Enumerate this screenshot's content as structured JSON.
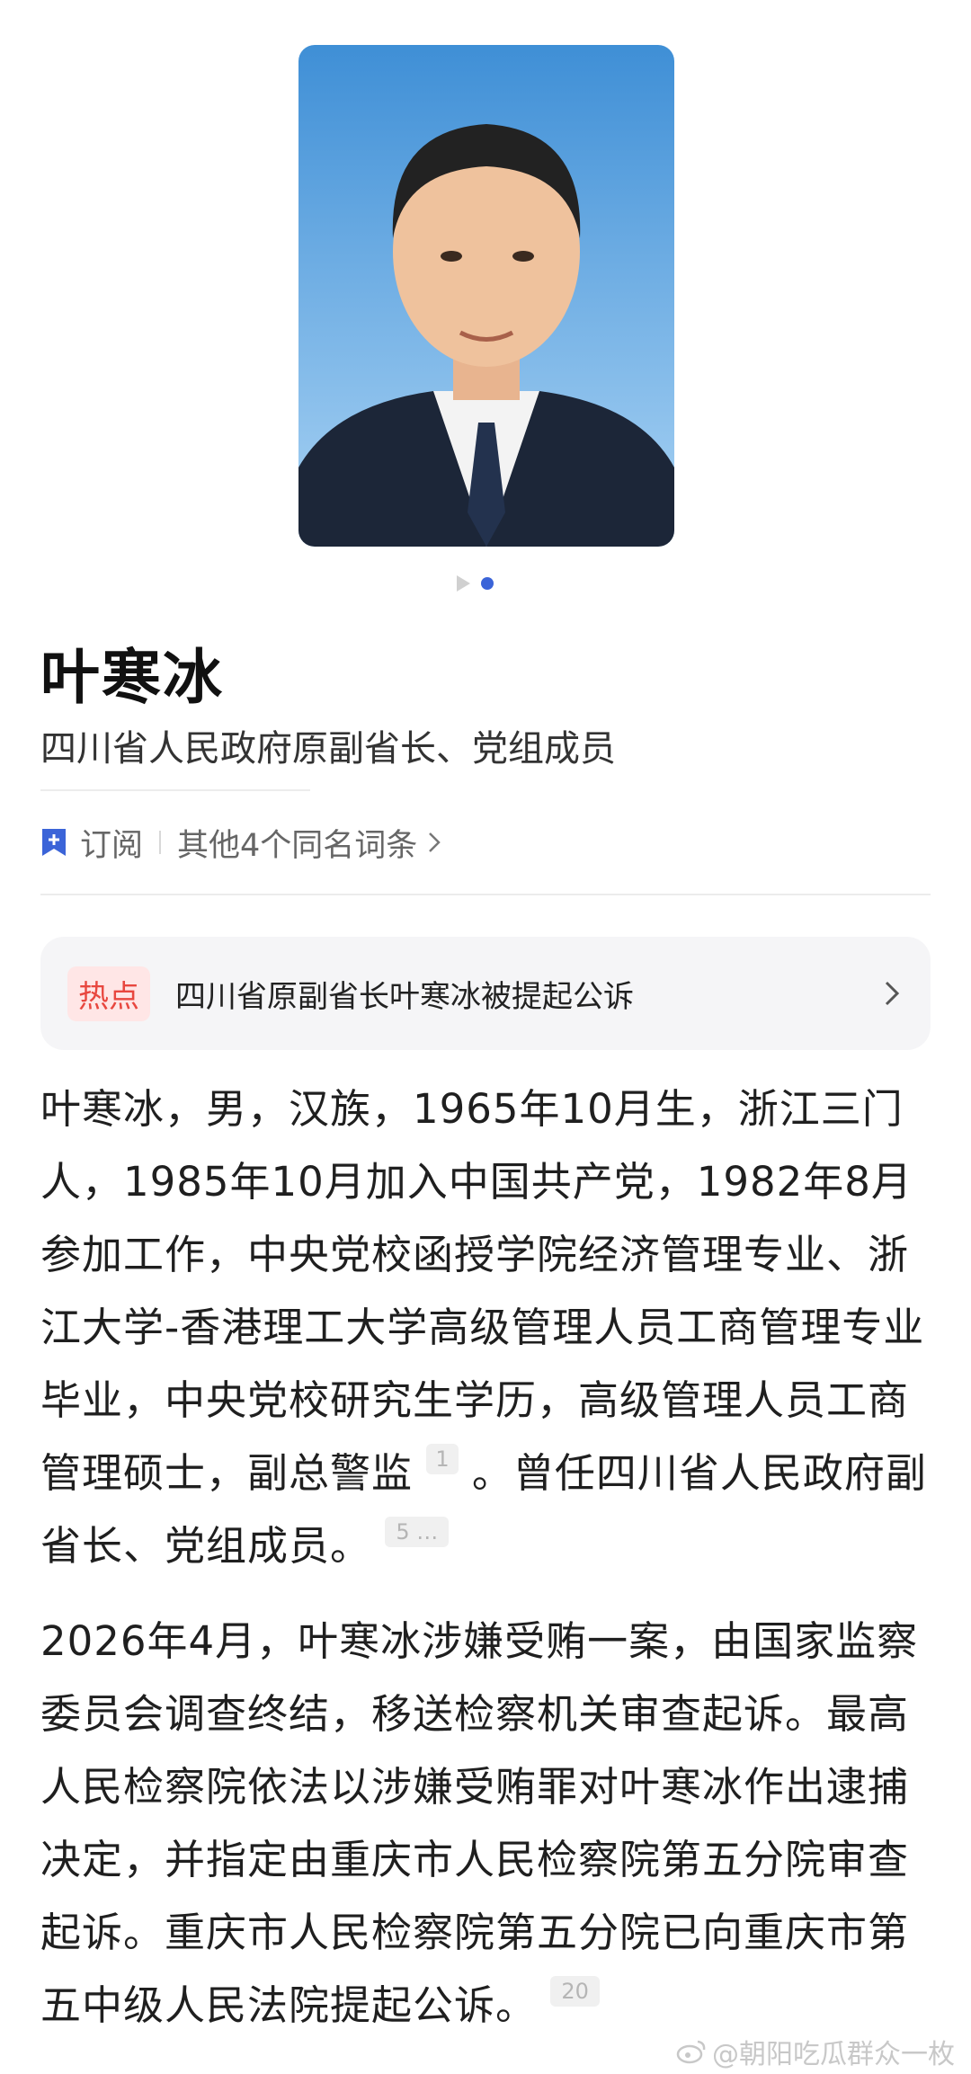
{
  "person": {
    "name": "叶寒冰",
    "title": "四川省人民政府原副省长、党组成员"
  },
  "actions": {
    "subscribe_label": "订阅",
    "other_entries_label": "其他4个同名词条"
  },
  "hot": {
    "tag": "热点",
    "text": "四川省原副省长叶寒冰被提起公诉"
  },
  "body": {
    "p1_text_a": "叶寒冰，男，汉族，1965年10月生，浙江三门人，1985年10月加入中国共产党，1982年8月参加工作，中央党校函授学院经济管理专业、浙江大学-香港理工大学高级管理人员工商管理专业毕业，中央党校研究生学历，高级管理人员工商管理硕士，副总警监",
    "p1_ref_a": "1",
    "p1_text_b": "。曾任四川省人民政府副省长、党组成员。",
    "p1_ref_b": "5 …",
    "p2_text": "2026年4月，叶寒冰涉嫌受贿一案，由国家监察委员会调查终结，移送检察机关审查起诉。最高人民检察院依法以涉嫌受贿罪对叶寒冰作出逮捕决定，并指定由重庆市人民检察院第五分院审查起诉。重庆市人民检察院第五分院已向重庆市第五中级人民法院提起公诉。",
    "p2_ref": "20"
  },
  "watermark": "@朝阳吃瓜群众一枚",
  "colors": {
    "accent_blue": "#3b64d8",
    "hot_red": "#e8473f",
    "hot_bg": "#ffe6e6"
  },
  "icons": [
    "portrait-photo",
    "bookmark-plus-icon",
    "chevron-right-icon",
    "weibo-icon"
  ]
}
